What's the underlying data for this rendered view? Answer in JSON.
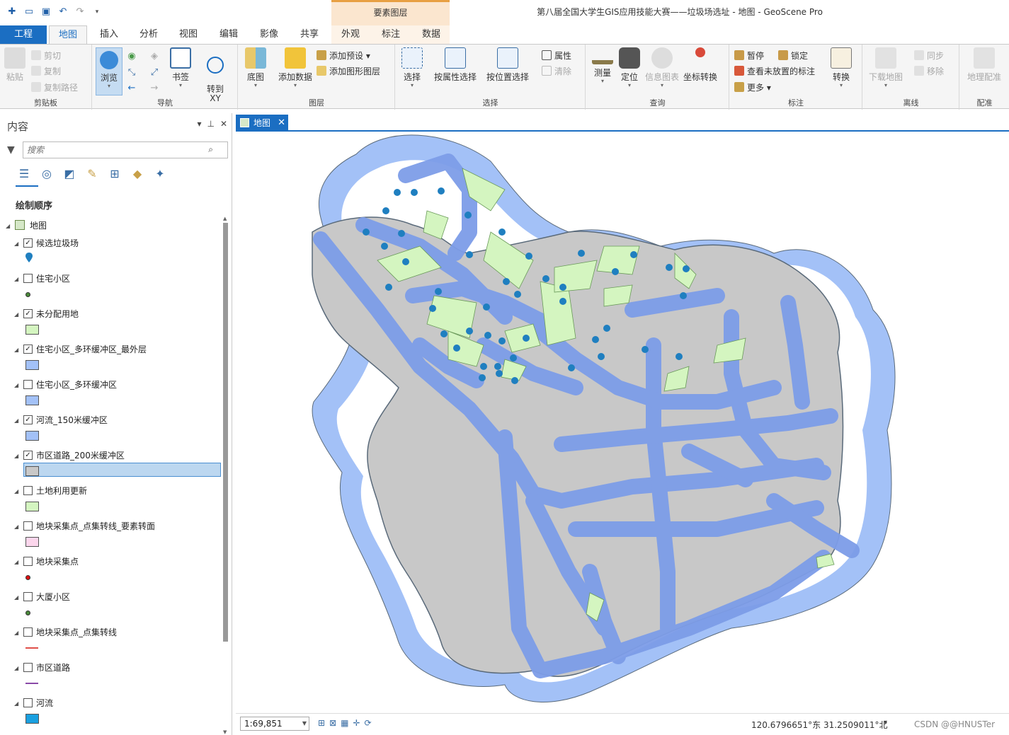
{
  "window": {
    "title": "第八届全国大学生GIS应用技能大赛——垃圾场选址 - 地图 - GeoScene Pro",
    "context_tab_header": "要素图层"
  },
  "ribbon_tabs": [
    "工程",
    "地图",
    "插入",
    "分析",
    "视图",
    "编辑",
    "影像",
    "共享",
    "外观",
    "标注",
    "数据"
  ],
  "ribbon": {
    "clipboard": {
      "group": "剪贴板",
      "paste": "粘贴",
      "cut": "剪切",
      "copy": "复制",
      "copy_path": "复制路径"
    },
    "navigate": {
      "group": "导航",
      "explore": "浏览",
      "bookmarks": "书签",
      "goto_xy": "转到\nXY"
    },
    "layer": {
      "group": "图层",
      "basemap": "底图",
      "add_data": "添加数据",
      "add_preset": "添加预设",
      "add_graphics": "添加图形图层"
    },
    "selection": {
      "group": "选择",
      "select": "选择",
      "by_attr": "按属性选择",
      "by_loc": "按位置选择",
      "attributes": "属性",
      "clear": "清除"
    },
    "inquiry": {
      "group": "查询",
      "measure": "测量",
      "locate": "定位",
      "infographics": "信息图表",
      "coord_convert": "坐标转换"
    },
    "labeling": {
      "group": "标注",
      "pause": "暂停",
      "lock": "锁定",
      "unplaced": "查看未放置的标注",
      "more": "更多",
      "convert": "转换"
    },
    "offline": {
      "group": "离线",
      "download": "下载地图",
      "sync": "同步",
      "remove": "移除"
    },
    "georef": {
      "group": "配准",
      "georeference": "地理配准"
    }
  },
  "contents": {
    "title": "内容",
    "search_placeholder": "搜索",
    "draw_order": "绘制顺序",
    "map_node": "地图",
    "layers": [
      {
        "name": "候选垃圾场",
        "checked": true,
        "symbol": "pin",
        "color": "#1f7fc0"
      },
      {
        "name": "住宅小区",
        "checked": false,
        "symbol": "point",
        "color": "#4a8a3a"
      },
      {
        "name": "未分配用地",
        "checked": true,
        "symbol": "polygon",
        "color": "#d4f5c0"
      },
      {
        "name": "住宅小区_多环缓冲区_最外层",
        "checked": true,
        "symbol": "polygon",
        "color": "#a3c1f7"
      },
      {
        "name": "住宅小区_多环缓冲区",
        "checked": false,
        "symbol": "polygon",
        "color": "#a3c1f7"
      },
      {
        "name": "河流_150米缓冲区",
        "checked": true,
        "symbol": "polygon",
        "color": "#a3c1f7"
      },
      {
        "name": "市区道路_200米缓冲区",
        "checked": true,
        "symbol": "polygon",
        "color": "#c8c8c8",
        "selected": true
      },
      {
        "name": "土地利用更新",
        "checked": false,
        "symbol": "polygon",
        "color": "#d4f5c0"
      },
      {
        "name": "地块采集点_点集转线_要素转面",
        "checked": false,
        "symbol": "polygon",
        "color": "#fcd6ec"
      },
      {
        "name": "地块采集点",
        "checked": false,
        "symbol": "point",
        "color": "#e01010"
      },
      {
        "name": "大厦小区",
        "checked": false,
        "symbol": "point",
        "color": "#4a8a3a"
      },
      {
        "name": "地块采集点_点集转线",
        "checked": false,
        "symbol": "line",
        "color": "#e0504a"
      },
      {
        "name": "市区道路",
        "checked": false,
        "symbol": "line",
        "color": "#8a4aa8"
      },
      {
        "name": "河流",
        "checked": false,
        "symbol": "polygon",
        "color": "#1aa0e0"
      }
    ]
  },
  "map_view": {
    "tab_label": "地图",
    "scale": "1:69,851",
    "coordinates": "120.6796651°东 31.2509011°北",
    "watermark": "CSDN @@HNUSTer"
  }
}
